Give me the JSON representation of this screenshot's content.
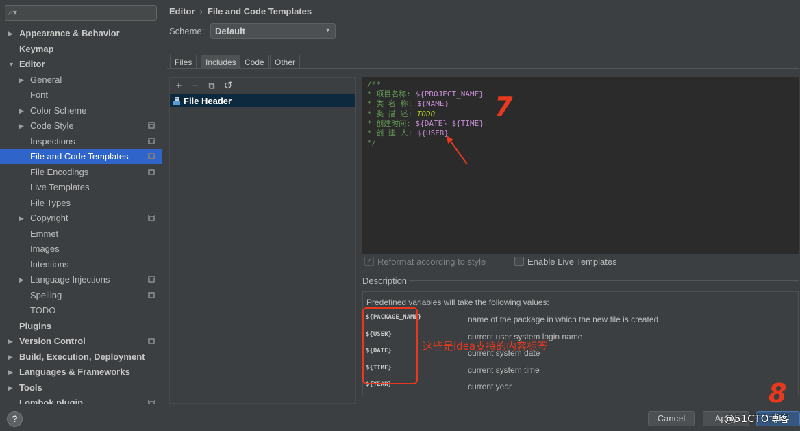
{
  "sidebar": {
    "search_placeholder": "",
    "items": [
      {
        "label": "Appearance & Behavior",
        "level": 0,
        "expander": "▶",
        "bold": true,
        "project": false,
        "selected": false
      },
      {
        "label": "Keymap",
        "level": 0,
        "expander": "",
        "bold": true,
        "project": false,
        "selected": false
      },
      {
        "label": "Editor",
        "level": 0,
        "expander": "▼",
        "bold": true,
        "project": false,
        "selected": false
      },
      {
        "label": "General",
        "level": 1,
        "expander": "▶",
        "bold": false,
        "project": false,
        "selected": false
      },
      {
        "label": "Font",
        "level": 1,
        "expander": "",
        "bold": false,
        "project": false,
        "selected": false
      },
      {
        "label": "Color Scheme",
        "level": 1,
        "expander": "▶",
        "bold": false,
        "project": false,
        "selected": false
      },
      {
        "label": "Code Style",
        "level": 1,
        "expander": "▶",
        "bold": false,
        "project": true,
        "selected": false
      },
      {
        "label": "Inspections",
        "level": 1,
        "expander": "",
        "bold": false,
        "project": true,
        "selected": false
      },
      {
        "label": "File and Code Templates",
        "level": 1,
        "expander": "",
        "bold": false,
        "project": true,
        "selected": true
      },
      {
        "label": "File Encodings",
        "level": 1,
        "expander": "",
        "bold": false,
        "project": true,
        "selected": false
      },
      {
        "label": "Live Templates",
        "level": 1,
        "expander": "",
        "bold": false,
        "project": false,
        "selected": false
      },
      {
        "label": "File Types",
        "level": 1,
        "expander": "",
        "bold": false,
        "project": false,
        "selected": false
      },
      {
        "label": "Copyright",
        "level": 1,
        "expander": "▶",
        "bold": false,
        "project": true,
        "selected": false
      },
      {
        "label": "Emmet",
        "level": 1,
        "expander": "",
        "bold": false,
        "project": false,
        "selected": false
      },
      {
        "label": "Images",
        "level": 1,
        "expander": "",
        "bold": false,
        "project": false,
        "selected": false
      },
      {
        "label": "Intentions",
        "level": 1,
        "expander": "",
        "bold": false,
        "project": false,
        "selected": false
      },
      {
        "label": "Language Injections",
        "level": 1,
        "expander": "▶",
        "bold": false,
        "project": true,
        "selected": false
      },
      {
        "label": "Spelling",
        "level": 1,
        "expander": "",
        "bold": false,
        "project": true,
        "selected": false
      },
      {
        "label": "TODO",
        "level": 1,
        "expander": "",
        "bold": false,
        "project": false,
        "selected": false
      },
      {
        "label": "Plugins",
        "level": 0,
        "expander": "",
        "bold": true,
        "project": false,
        "selected": false
      },
      {
        "label": "Version Control",
        "level": 0,
        "expander": "▶",
        "bold": true,
        "project": true,
        "selected": false
      },
      {
        "label": "Build, Execution, Deployment",
        "level": 0,
        "expander": "▶",
        "bold": true,
        "project": false,
        "selected": false
      },
      {
        "label": "Languages & Frameworks",
        "level": 0,
        "expander": "▶",
        "bold": true,
        "project": false,
        "selected": false
      },
      {
        "label": "Tools",
        "level": 0,
        "expander": "▶",
        "bold": true,
        "project": false,
        "selected": false
      },
      {
        "label": "Lombok plugin",
        "level": 0,
        "expander": "",
        "bold": true,
        "project": true,
        "selected": false
      }
    ]
  },
  "header": {
    "breadcrumb_root": "Editor",
    "breadcrumb_sep": "›",
    "breadcrumb_page": "File and Code Templates",
    "scheme_label": "Scheme:",
    "scheme_value": "Default"
  },
  "tabs": [
    {
      "label": "Files",
      "active": false
    },
    {
      "label": "Includes",
      "active": true
    },
    {
      "label": "Code",
      "active": false
    },
    {
      "label": "Other",
      "active": false
    }
  ],
  "toolbar": {
    "add": "+",
    "remove": "−",
    "copy": "⧉",
    "reset": "↺"
  },
  "templates": [
    {
      "name": "File Header"
    }
  ],
  "editor": {
    "lines": [
      [
        {
          "t": "/**",
          "c": "com"
        }
      ],
      [
        {
          "t": "* 项目名称: ",
          "c": "com"
        },
        {
          "t": "${PROJECT_NAME}",
          "c": "var"
        }
      ],
      [
        {
          "t": "* 类 名 称: ",
          "c": "com"
        },
        {
          "t": "${NAME}",
          "c": "var"
        }
      ],
      [
        {
          "t": "* 类 描 述: ",
          "c": "com"
        },
        {
          "t": "TODO",
          "c": "todo"
        }
      ],
      [
        {
          "t": "* 创建时间: ",
          "c": "com"
        },
        {
          "t": "${DATE}",
          "c": "var"
        },
        {
          "t": " ",
          "c": "com"
        },
        {
          "t": "${TIME}",
          "c": "var"
        }
      ],
      [
        {
          "t": "* 创 建 人: ",
          "c": "com"
        },
        {
          "t": "${USER}",
          "c": "var"
        }
      ],
      [
        {
          "t": "*/",
          "c": "com"
        }
      ]
    ]
  },
  "options": {
    "reformat_label": "Reformat according to style",
    "reformat_checked": true,
    "live_templates_label": "Enable Live Templates",
    "live_templates_checked": false
  },
  "description": {
    "title": "Description",
    "intro": "Predefined variables will take the following values:",
    "variables": [
      {
        "name": "${PACKAGE_NAME}",
        "desc": "name of the package in which the new file is created"
      },
      {
        "name": "${USER}",
        "desc": "current user system login name"
      },
      {
        "name": "${DATE}",
        "desc": "current system date"
      },
      {
        "name": "${TIME}",
        "desc": "current system time"
      },
      {
        "name": "${YEAR}",
        "desc": "current year"
      }
    ]
  },
  "annotations": {
    "step7": "7",
    "step8": "8",
    "note": "这些是idea支持的内容标签",
    "color": "#e8391e"
  },
  "footer": {
    "help": "?",
    "cancel": "Cancel",
    "apply": "Apply",
    "ok": "OK",
    "watermark": "@51CTO博客"
  },
  "colors": {
    "selection": "#2f65ca",
    "background": "#3c3f41",
    "editor_bg": "#2b2b2b",
    "comment": "#629755",
    "variable": "#c58cd4"
  }
}
